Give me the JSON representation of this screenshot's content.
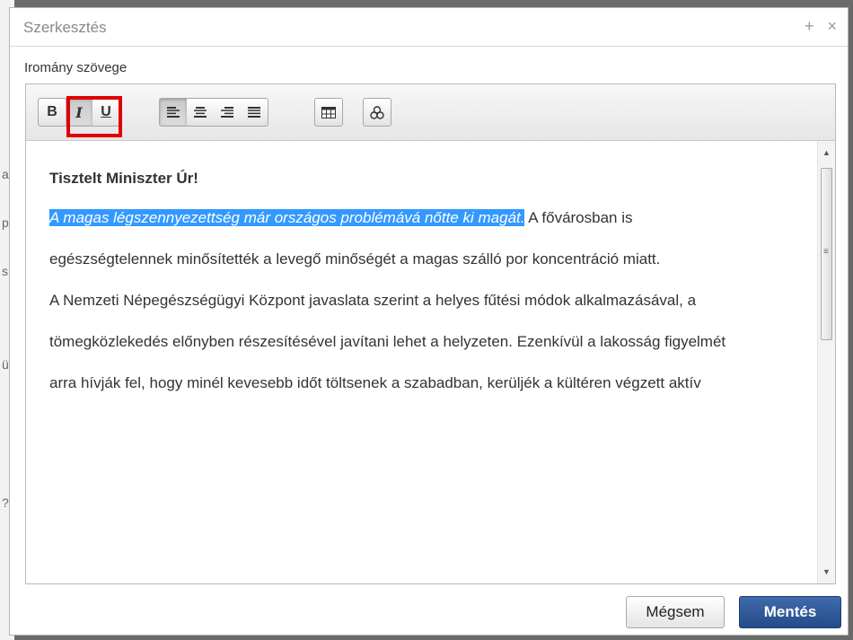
{
  "background_page": {
    "fragments": [
      "a",
      "p",
      "s",
      "ü",
      "?"
    ]
  },
  "dialog": {
    "title": "Szerkesztés",
    "controls": {
      "expand": "+",
      "close": "×"
    },
    "field_label": "Iromány szövege"
  },
  "toolbar": {
    "bold": "B",
    "italic": "I",
    "underline": "U",
    "align_left_icon": "align-left-icon",
    "align_center_icon": "align-center-icon",
    "align_right_icon": "align-right-icon",
    "align_justify_icon": "align-justify-icon",
    "table_icon": "table-icon",
    "source_icon": "source-code-icon",
    "highlight_color": "#e00000"
  },
  "content": {
    "heading": "Tisztelt Miniszter Úr!",
    "selected_text": "A magas légszennyezettség már országos problémává nőtte ki magát.",
    "after_selection": " A fővárosban is",
    "paragraphs": [
      "egészségtelennek minősítették a levegő minőségét a magas szálló por koncentráció miatt.",
      "A Nemzeti Népegészségügyi Központ javaslata szerint a helyes fűtési módok alkalmazásával, a",
      "tömegközlekedés előnyben részesítésével javítani lehet a helyzeten. Ezenkívül a lakosság figyelmét",
      "arra hívják fel, hogy minél kevesebb időt töltsenek a szabadban, kerüljék a kültéren végzett aktív"
    ],
    "selection_color": "#3399ff"
  },
  "scrollbar": {
    "up_arrow": "▲",
    "down_arrow": "▼",
    "grip": "≡"
  },
  "footer": {
    "cancel_label": "Mégsem",
    "save_label": "Mentés",
    "save_color": "#2d5696"
  }
}
